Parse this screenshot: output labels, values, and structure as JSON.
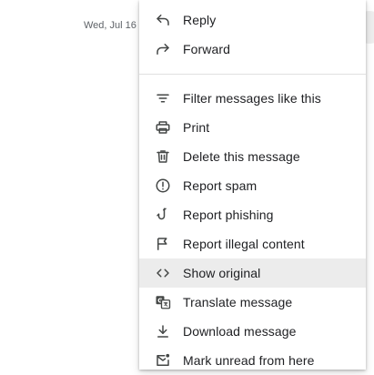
{
  "background": {
    "date": "Wed, Jul 16"
  },
  "menu": {
    "groups": [
      [
        {
          "label": "Reply",
          "icon": "reply-icon"
        },
        {
          "label": "Forward",
          "icon": "forward-icon"
        }
      ],
      [
        {
          "label": "Filter messages like this",
          "icon": "filter-icon"
        },
        {
          "label": "Print",
          "icon": "print-icon"
        },
        {
          "label": "Delete this message",
          "icon": "trash-icon"
        },
        {
          "label": "Report spam",
          "icon": "spam-icon"
        },
        {
          "label": "Report phishing",
          "icon": "phishing-hook-icon"
        },
        {
          "label": "Report illegal content",
          "icon": "flag-icon"
        },
        {
          "label": "Show original",
          "icon": "code-icon",
          "highlighted": true
        },
        {
          "label": "Translate message",
          "icon": "translate-icon"
        },
        {
          "label": "Download message",
          "icon": "download-icon"
        },
        {
          "label": "Mark unread from here",
          "icon": "mark-unread-icon"
        }
      ]
    ]
  },
  "colors": {
    "text": "#202124",
    "icon": "#444746",
    "hover": "#ececec",
    "divider": "#e0e0e0"
  }
}
